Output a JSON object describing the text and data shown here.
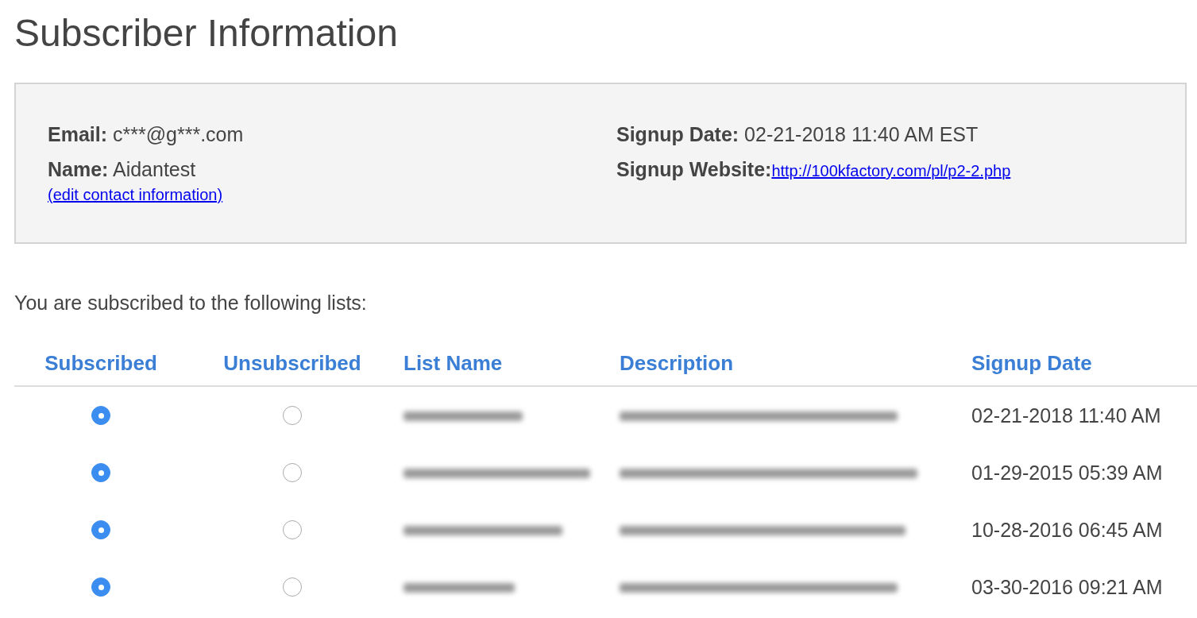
{
  "title": "Subscriber Information",
  "contact": {
    "left": [
      {
        "label": "Email:",
        "value": "c***@g***.com"
      },
      {
        "label": "Name:",
        "value": "Aidantest"
      }
    ],
    "edit_link": "(edit contact information)",
    "right": [
      {
        "label": "Signup Date:",
        "value": "02-21-2018 11:40 AM EST",
        "kind": "text"
      },
      {
        "label": "Signup Website:",
        "value": "http://100kfactory.com/pl/p2-2.php",
        "kind": "link"
      }
    ]
  },
  "intro": "You are subscribed to the following lists:",
  "table": {
    "columns": [
      "Subscribed",
      "Unsubscribed",
      "List Name",
      "Description",
      "Signup Date"
    ],
    "rows": [
      {
        "subscribed": true,
        "signup_date": "02-21-2018 11:40 AM"
      },
      {
        "subscribed": true,
        "signup_date": "01-29-2015 05:39 AM"
      },
      {
        "subscribed": true,
        "signup_date": "10-28-2016 06:45 AM"
      },
      {
        "subscribed": true,
        "signup_date": "03-30-2016 09:21 AM"
      }
    ]
  }
}
